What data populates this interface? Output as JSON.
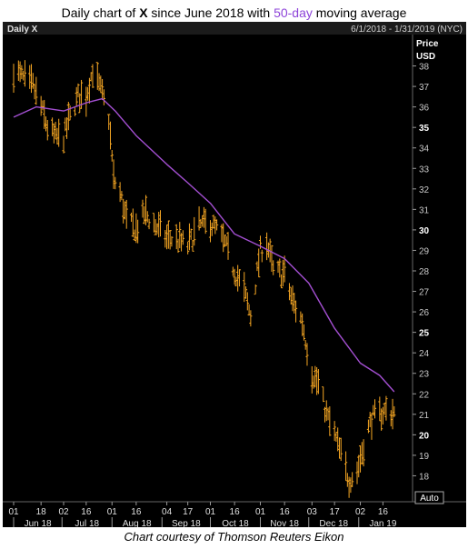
{
  "header": {
    "title_pre": "Daily chart of ",
    "ticker": "X",
    "title_mid": " since June 2018 with ",
    "ma_label": "50-day",
    "title_post": " moving average"
  },
  "caption": "Chart courtesy of Thomson Reuters Eikon",
  "colors": {
    "background": "#000000",
    "price": "#f5a623",
    "ma": "#a34fd1",
    "axis": "#bbbbbb"
  },
  "chart_data": {
    "type": "bar",
    "panel_label": "Daily X",
    "date_range": "6/1/2018 - 1/31/2019 (NYC)",
    "ylabel": "Price",
    "yunit": "USD",
    "yscale_button": "Auto",
    "ylim": [
      17,
      39
    ],
    "y_ticks": [
      18,
      19,
      20,
      21,
      22,
      23,
      24,
      25,
      26,
      27,
      28,
      29,
      30,
      31,
      32,
      33,
      34,
      35,
      36,
      37,
      38
    ],
    "y_ticks_bold": [
      20,
      25,
      30,
      35
    ],
    "x_day_ticks": [
      "01",
      "18",
      "02",
      "16",
      "01",
      "16",
      "04",
      "17",
      "01",
      "16",
      "01",
      "16",
      "03",
      "17",
      "02",
      "16"
    ],
    "x_day_tick_dates": [
      "2018-06-01",
      "2018-06-18",
      "2018-07-02",
      "2018-07-16",
      "2018-08-01",
      "2018-08-16",
      "2018-09-04",
      "2018-09-17",
      "2018-10-01",
      "2018-10-16",
      "2018-11-01",
      "2018-11-16",
      "2018-12-03",
      "2018-12-17",
      "2019-01-02",
      "2019-01-16"
    ],
    "x_month_labels": [
      "Jun 18",
      "Jul 18",
      "Aug 18",
      "Sep 18",
      "Oct 18",
      "Nov 18",
      "Dec 18",
      "Jan 19"
    ],
    "x_month_dates": [
      "2018-06-01",
      "2018-07-01",
      "2018-08-01",
      "2018-09-01",
      "2018-10-01",
      "2018-11-01",
      "2018-12-01",
      "2019-01-01"
    ],
    "x_end": "2019-01-31",
    "price_series": {
      "name": "X",
      "points": [
        [
          "2018-06-01",
          37.8
        ],
        [
          "2018-06-08",
          37.3
        ],
        [
          "2018-06-13",
          37.0
        ],
        [
          "2018-06-18",
          36.0
        ],
        [
          "2018-06-22",
          35.0
        ],
        [
          "2018-06-27",
          34.5
        ],
        [
          "2018-07-02",
          34.5
        ],
        [
          "2018-07-06",
          35.5
        ],
        [
          "2018-07-11",
          36.5
        ],
        [
          "2018-07-16",
          36.5
        ],
        [
          "2018-07-20",
          37.8
        ],
        [
          "2018-07-25",
          36.8
        ],
        [
          "2018-07-30",
          35.5
        ],
        [
          "2018-08-02",
          32.5
        ],
        [
          "2018-08-06",
          31.8
        ],
        [
          "2018-08-10",
          30.5
        ],
        [
          "2018-08-16",
          30.0
        ],
        [
          "2018-08-21",
          30.8
        ],
        [
          "2018-08-27",
          30.3
        ],
        [
          "2018-09-04",
          29.6
        ],
        [
          "2018-09-10",
          29.5
        ],
        [
          "2018-09-17",
          29.2
        ],
        [
          "2018-09-24",
          30.2
        ],
        [
          "2018-10-01",
          30.3
        ],
        [
          "2018-10-05",
          30.0
        ],
        [
          "2018-10-10",
          29.3
        ],
        [
          "2018-10-16",
          28.0
        ],
        [
          "2018-10-22",
          27.0
        ],
        [
          "2018-10-26",
          25.8
        ],
        [
          "2018-11-01",
          29.0
        ],
        [
          "2018-11-05",
          29.4
        ],
        [
          "2018-11-09",
          28.0
        ],
        [
          "2018-11-16",
          27.8
        ],
        [
          "2018-11-21",
          26.5
        ],
        [
          "2018-11-27",
          25.5
        ],
        [
          "2018-12-03",
          23.0
        ],
        [
          "2018-12-07",
          22.5
        ],
        [
          "2018-12-12",
          21.0
        ],
        [
          "2018-12-17",
          20.0
        ],
        [
          "2018-12-21",
          19.0
        ],
        [
          "2018-12-26",
          17.8
        ],
        [
          "2018-12-31",
          18.2
        ],
        [
          "2019-01-04",
          19.5
        ],
        [
          "2019-01-09",
          20.8
        ],
        [
          "2019-01-14",
          21.0
        ],
        [
          "2019-01-18",
          21.2
        ],
        [
          "2019-01-23",
          21.0
        ]
      ]
    },
    "ma_series": {
      "name": "50-day",
      "points": [
        [
          "2018-06-01",
          35.5
        ],
        [
          "2018-06-15",
          36.0
        ],
        [
          "2018-07-02",
          35.8
        ],
        [
          "2018-07-16",
          36.2
        ],
        [
          "2018-07-26",
          36.4
        ],
        [
          "2018-08-03",
          35.8
        ],
        [
          "2018-08-16",
          34.6
        ],
        [
          "2018-09-04",
          33.2
        ],
        [
          "2018-09-17",
          32.3
        ],
        [
          "2018-10-01",
          31.3
        ],
        [
          "2018-10-16",
          29.8
        ],
        [
          "2018-11-01",
          29.2
        ],
        [
          "2018-11-16",
          28.6
        ],
        [
          "2018-12-01",
          27.4
        ],
        [
          "2018-12-17",
          25.2
        ],
        [
          "2019-01-02",
          23.5
        ],
        [
          "2019-01-14",
          22.9
        ],
        [
          "2019-01-23",
          22.1
        ]
      ]
    }
  }
}
